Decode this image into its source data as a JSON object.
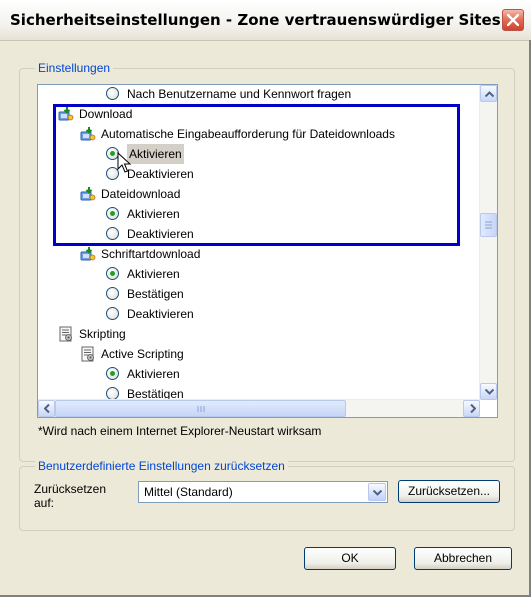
{
  "window": {
    "title": "Sicherheitseinstellungen - Zone vertrauenswürdiger Sites"
  },
  "settings_group": {
    "legend": "Einstellungen",
    "tree": [
      {
        "kind": "radio",
        "checked": false,
        "label": "Nach Benutzername und Kennwort fragen"
      },
      {
        "kind": "group",
        "icon": "download-settings-icon",
        "label": "Download"
      },
      {
        "kind": "group",
        "icon": "download-settings-icon",
        "label": "Automatische Eingabeaufforderung für Dateidownloads"
      },
      {
        "kind": "radio",
        "checked": true,
        "label": "Aktivieren",
        "selected": true
      },
      {
        "kind": "radio",
        "checked": false,
        "label": "Deaktivieren"
      },
      {
        "kind": "group",
        "icon": "download-settings-icon",
        "label": "Dateidownload"
      },
      {
        "kind": "radio",
        "checked": true,
        "label": "Aktivieren"
      },
      {
        "kind": "radio",
        "checked": false,
        "label": "Deaktivieren"
      },
      {
        "kind": "group",
        "icon": "download-settings-icon",
        "label": "Schriftartdownload"
      },
      {
        "kind": "radio",
        "checked": true,
        "label": "Aktivieren"
      },
      {
        "kind": "radio",
        "checked": false,
        "label": "Bestätigen"
      },
      {
        "kind": "radio",
        "checked": false,
        "label": "Deaktivieren"
      },
      {
        "kind": "group",
        "icon": "script-settings-icon",
        "label": "Skripting"
      },
      {
        "kind": "group",
        "icon": "script-settings-icon",
        "label": "Active Scripting"
      },
      {
        "kind": "radio",
        "checked": true,
        "label": "Aktivieren"
      },
      {
        "kind": "radio",
        "checked": false,
        "label": "Bestätigen"
      }
    ],
    "note": "*Wird nach einem Internet Explorer-Neustart wirksam"
  },
  "reset_group": {
    "legend": "Benutzerdefinierte Einstellungen zurücksetzen",
    "label_line1": "Zurücksetzen",
    "label_line2": "auf:",
    "dropdown_value": "Mittel (Standard)",
    "reset_button": "Zurücksetzen..."
  },
  "buttons": {
    "ok": "OK",
    "cancel": "Abbrechen"
  },
  "colors": {
    "accent_blue": "#0046d5",
    "highlight_border": "#0000c8",
    "close_red": "#e06b55"
  }
}
